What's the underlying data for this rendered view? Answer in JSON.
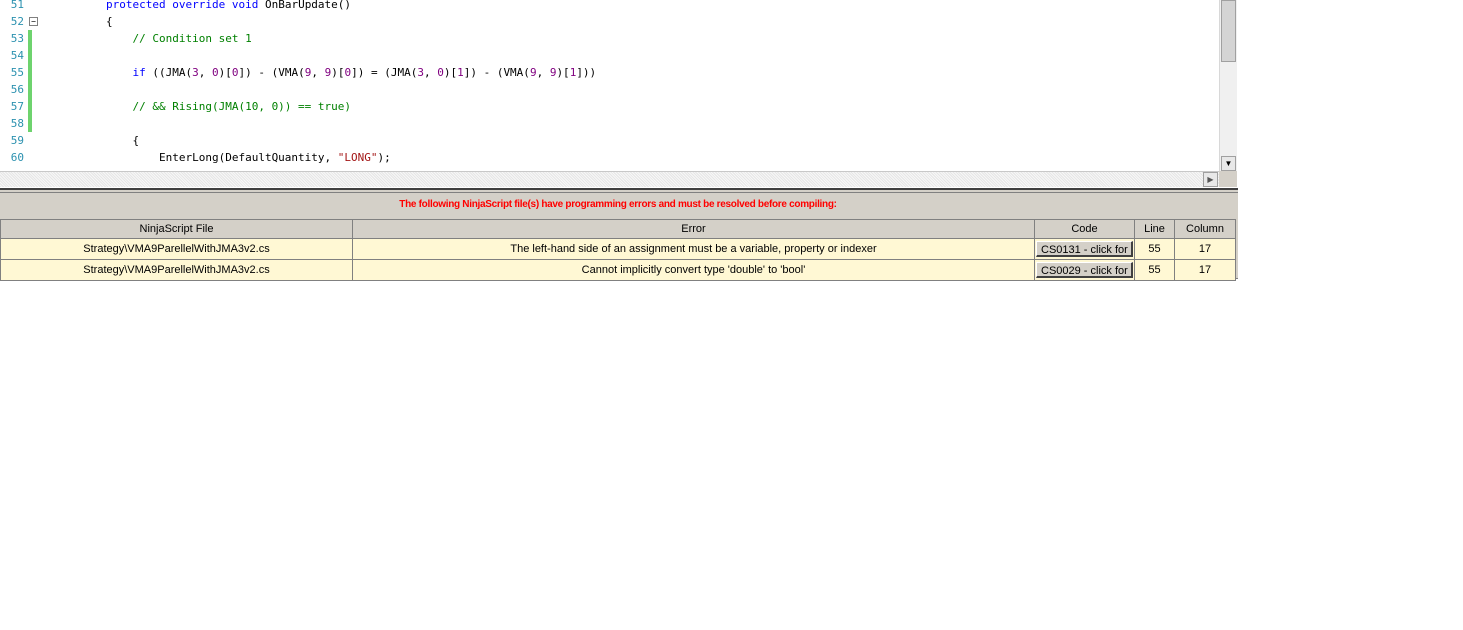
{
  "editor": {
    "lines": [
      {
        "num": "51",
        "parts": [
          {
            "t": "protected override void ",
            "c": "kw"
          },
          {
            "t": "OnBarUpdate()",
            "c": "pl"
          }
        ]
      },
      {
        "num": "52",
        "parts": [
          {
            "t": "{",
            "c": "pl"
          }
        ],
        "fold": "−"
      },
      {
        "num": "53",
        "parts": [
          {
            "t": "    // Condition set 1",
            "c": "cm"
          }
        ],
        "changed": true
      },
      {
        "num": "54",
        "parts": [],
        "changed": true
      },
      {
        "num": "55",
        "parts": [
          {
            "t": "    if ",
            "c": "kw"
          },
          {
            "t": "((JMA(",
            "c": "pl"
          },
          {
            "t": "3",
            "c": "nm"
          },
          {
            "t": ", ",
            "c": "pl"
          },
          {
            "t": "0",
            "c": "nm"
          },
          {
            "t": ")[",
            "c": "pl"
          },
          {
            "t": "0",
            "c": "nm"
          },
          {
            "t": "]) - (VMA(",
            "c": "pl"
          },
          {
            "t": "9",
            "c": "nm"
          },
          {
            "t": ", ",
            "c": "pl"
          },
          {
            "t": "9",
            "c": "nm"
          },
          {
            "t": ")[",
            "c": "pl"
          },
          {
            "t": "0",
            "c": "nm"
          },
          {
            "t": "]) = (JMA(",
            "c": "pl"
          },
          {
            "t": "3",
            "c": "nm"
          },
          {
            "t": ", ",
            "c": "pl"
          },
          {
            "t": "0",
            "c": "nm"
          },
          {
            "t": ")[",
            "c": "pl"
          },
          {
            "t": "1",
            "c": "nm"
          },
          {
            "t": "]) - (VMA(",
            "c": "pl"
          },
          {
            "t": "9",
            "c": "nm"
          },
          {
            "t": ", ",
            "c": "pl"
          },
          {
            "t": "9",
            "c": "nm"
          },
          {
            "t": ")[",
            "c": "pl"
          },
          {
            "t": "1",
            "c": "nm"
          },
          {
            "t": "]))",
            "c": "pl"
          }
        ],
        "changed": true
      },
      {
        "num": "56",
        "parts": [],
        "changed": true
      },
      {
        "num": "57",
        "parts": [
          {
            "t": "    // && Rising(JMA(10, 0)) == true)",
            "c": "cm"
          }
        ],
        "changed": true
      },
      {
        "num": "58",
        "parts": [],
        "changed": true
      },
      {
        "num": "59",
        "parts": [
          {
            "t": "    {",
            "c": "pl"
          }
        ]
      },
      {
        "num": "60",
        "parts": [
          {
            "t": "        EnterLong(DefaultQuantity, ",
            "c": "pl"
          },
          {
            "t": "\"LONG\"",
            "c": "st"
          },
          {
            "t": ");",
            "c": "pl"
          }
        ]
      }
    ]
  },
  "error_panel": {
    "banner": "The following NinjaScript file(s) have programming errors and must be resolved before compiling:",
    "columns": [
      "NinjaScript File",
      "Error",
      "Code",
      "Line",
      "Column"
    ],
    "rows": [
      {
        "file": "Strategy\\VMA9ParellelWithJMA3v2.cs",
        "error": "The left-hand side of an assignment must be a variable, property or indexer",
        "code": "CS0131 - click for",
        "line": "55",
        "column": "17"
      },
      {
        "file": "Strategy\\VMA9ParellelWithJMA3v2.cs",
        "error": "Cannot implicitly convert type 'double' to 'bool'",
        "code": "CS0029 - click for",
        "line": "55",
        "column": "17"
      }
    ]
  },
  "icons": {
    "fold": "fold-collapse-icon",
    "scroll_down": "scroll-down-arrow-icon",
    "scroll_right": "scroll-right-arrow-icon"
  }
}
